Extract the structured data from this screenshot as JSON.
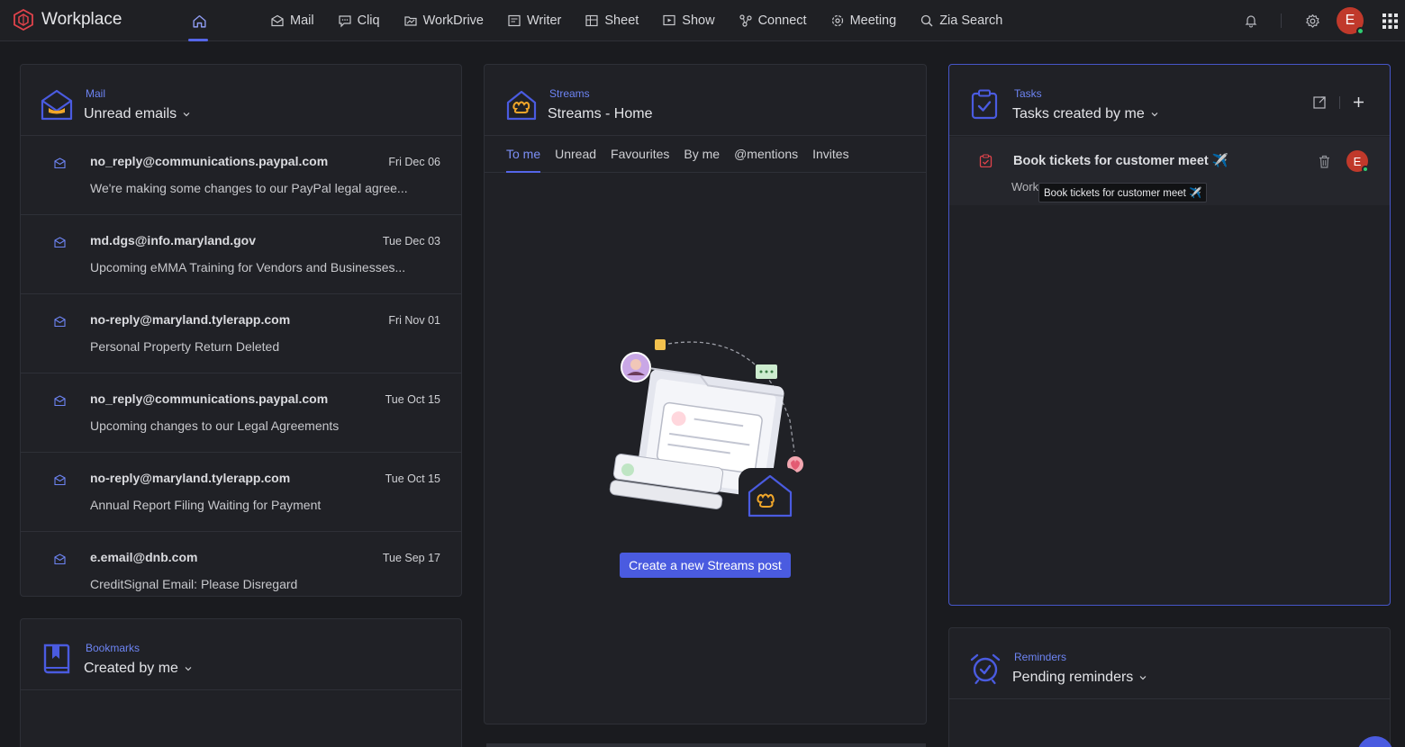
{
  "app": {
    "name": "Workplace",
    "colors": {
      "accent": "#5566e8",
      "background": "#1a1b1f",
      "card": "#202126",
      "avatar": "#c0392b",
      "online": "#2ecc71"
    }
  },
  "nav": {
    "items": [
      {
        "label": "Mail",
        "icon": "mail-icon"
      },
      {
        "label": "Cliq",
        "icon": "chat-icon"
      },
      {
        "label": "WorkDrive",
        "icon": "folder-icon"
      },
      {
        "label": "Writer",
        "icon": "writer-icon"
      },
      {
        "label": "Sheet",
        "icon": "sheet-icon"
      },
      {
        "label": "Show",
        "icon": "show-icon"
      },
      {
        "label": "Connect",
        "icon": "connect-icon"
      },
      {
        "label": "Meeting",
        "icon": "meeting-icon"
      },
      {
        "label": "Zia Search",
        "icon": "search-icon"
      }
    ],
    "avatar_initial": "E"
  },
  "mail": {
    "kicker": "Mail",
    "title": "Unread emails",
    "items": [
      {
        "from": "no_reply@communications.paypal.com",
        "date": "Fri Dec 06",
        "subject": "We're making some changes to our PayPal legal agree..."
      },
      {
        "from": "md.dgs@info.maryland.gov",
        "date": "Tue Dec 03",
        "subject": "Upcoming eMMA Training for Vendors and Businesses..."
      },
      {
        "from": "no-reply@maryland.tylerapp.com",
        "date": "Fri Nov 01",
        "subject": "Personal Property Return Deleted"
      },
      {
        "from": "no_reply@communications.paypal.com",
        "date": "Tue Oct 15",
        "subject": "Upcoming changes to our Legal Agreements"
      },
      {
        "from": "no-reply@maryland.tylerapp.com",
        "date": "Tue Oct 15",
        "subject": "Annual Report Filing Waiting for Payment"
      },
      {
        "from": "e.email@dnb.com",
        "date": "Tue Sep 17",
        "subject": "CreditSignal Email: Please Disregard"
      }
    ]
  },
  "bookmarks": {
    "kicker": "Bookmarks",
    "title": "Created by me"
  },
  "streams": {
    "kicker": "Streams",
    "title": "Streams - Home",
    "tabs": [
      "To me",
      "Unread",
      "Favourites",
      "By me",
      "@mentions",
      "Invites"
    ],
    "create_label": "Create a new Streams post"
  },
  "tasks": {
    "kicker": "Tasks",
    "title": "Tasks created by me",
    "item": {
      "title": "Book tickets for customer meet ✈️",
      "sub": "Work",
      "assignee": "E"
    },
    "tooltip": "Book tickets for customer meet ✈️"
  },
  "reminders": {
    "kicker": "Reminders",
    "title": "Pending reminders"
  }
}
